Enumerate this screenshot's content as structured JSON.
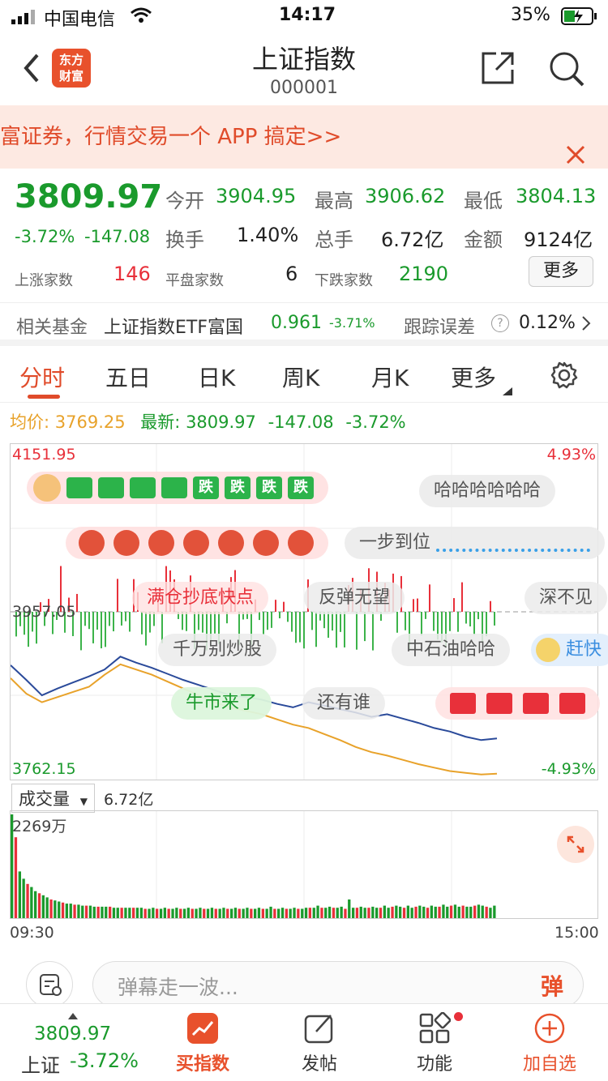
{
  "status": {
    "carrier": "中国电信",
    "time": "14:17",
    "battery": "35%"
  },
  "nav": {
    "title": "上证指数",
    "code": "000001",
    "logo_line1": "东方",
    "logo_line2": "财富"
  },
  "banner": {
    "text": "富证券，行情交易一个 APP 搞定>>"
  },
  "quote": {
    "price": "3809.97",
    "change_pct": "-3.72%",
    "change": "-147.08",
    "open_label": "今开",
    "open": "3904.95",
    "high_label": "最高",
    "high": "3906.62",
    "low_label": "最低",
    "low": "3804.13",
    "turnover_label": "换手",
    "turnover": "1.40%",
    "volume_label": "总手",
    "volume": "6.72亿",
    "amount_label": "金额",
    "amount": "9124亿",
    "up_label": "上涨家数",
    "up": "146",
    "flat_label": "平盘家数",
    "flat": "6",
    "down_label": "下跌家数",
    "down": "2190",
    "more_button": "更多"
  },
  "fund": {
    "label": "相关基金",
    "name": "上证指数ETF富国",
    "price": "0.961",
    "pct": "-3.71%",
    "err_label": "跟踪误差",
    "err": "0.12%"
  },
  "tabs": [
    "分时",
    "五日",
    "日K",
    "周K",
    "月K",
    "更多"
  ],
  "pricebar": {
    "avg_label": "均价:",
    "avg": "3769.25",
    "latest_label": "最新:",
    "latest": "3809.97",
    "chg": "-147.08",
    "pct": "-3.72%"
  },
  "chart_data": {
    "type": "line",
    "y_top": "4151.95",
    "y_mid": "3957.05",
    "y_bottom": "3762.15",
    "pct_top": "4.93%",
    "pct_bottom": "-4.93%",
    "series": [
      {
        "values": [
          3895,
          3878,
          3860,
          3868,
          3875,
          3882,
          3890,
          3905,
          3898,
          3892,
          3885,
          3878,
          3872,
          3866,
          3860,
          3858,
          3855,
          3850,
          3846,
          3852,
          3848,
          3844,
          3840,
          3835,
          3838,
          3833,
          3828,
          3822,
          3818,
          3812,
          3808,
          3810
        ]
      },
      {
        "values": [
          3880,
          3862,
          3852,
          3858,
          3864,
          3870,
          3884,
          3896,
          3890,
          3884,
          3876,
          3868,
          3860,
          3852,
          3846,
          3842,
          3838,
          3832,
          3826,
          3822,
          3815,
          3808,
          3800,
          3794,
          3790,
          3785,
          3780,
          3776,
          3772,
          3770,
          3768,
          3769
        ]
      }
    ]
  },
  "danmu": [
    "哈哈哈哈哈哈",
    "一步到位",
    "满仓抄底快点",
    "反弹无望",
    "深不见",
    "千万别炒股",
    "中石油哈哈",
    "赶快",
    "牛市来了",
    "还有谁"
  ],
  "danmu_badges": [
    "跌",
    "跌",
    "跌",
    "跌"
  ],
  "volume": {
    "selector": "成交量",
    "total": "6.72亿",
    "max": "2269万",
    "start_time": "09:30",
    "end_time": "15:00",
    "bars": [
      100,
      78,
      45,
      38,
      33,
      30,
      26,
      24,
      22,
      20,
      18,
      17,
      16,
      15,
      14,
      14,
      13,
      13,
      12,
      12,
      12,
      11,
      11,
      11,
      11,
      11,
      10,
      10,
      10,
      10,
      10,
      10,
      10,
      10,
      9,
      9,
      10,
      9,
      9,
      10,
      9,
      9,
      10,
      9,
      9,
      10,
      9,
      9,
      10,
      9,
      9,
      10,
      9,
      9,
      10,
      9,
      9,
      10,
      9,
      9,
      10,
      9,
      9,
      10,
      9,
      9,
      11,
      9,
      9,
      10,
      9,
      9,
      10,
      9,
      9,
      10,
      10,
      10,
      12,
      10,
      10,
      11,
      10,
      10,
      11,
      9,
      18,
      10,
      10,
      11,
      10,
      10,
      11,
      10,
      10,
      12,
      10,
      11,
      12,
      11,
      10,
      12,
      10,
      11,
      12,
      11,
      10,
      12,
      11,
      11,
      13,
      11,
      12,
      13,
      11,
      12,
      11,
      11,
      12,
      13,
      12,
      11,
      10,
      12
    ]
  },
  "danmu_input": {
    "placeholder": "弹幕走一波...",
    "send": "弹"
  },
  "bottom": {
    "index_price": "3809.97",
    "index_label": "上证",
    "index_pct": "-3.72%",
    "buy": "买指数",
    "post": "发帖",
    "func": "功能",
    "add": "加自选"
  }
}
